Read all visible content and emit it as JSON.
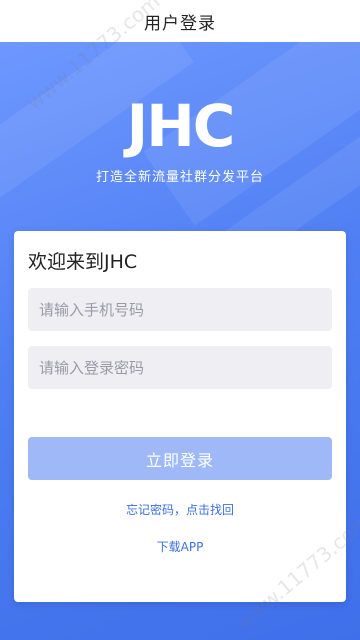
{
  "header": {
    "title": "用户登录"
  },
  "hero": {
    "logo_text": "JHC",
    "slogan": "打造全新流量社群分发平台"
  },
  "login_card": {
    "welcome": "欢迎来到JHC",
    "phone_placeholder": "请输入手机号码",
    "password_placeholder": "请输入登录密码",
    "login_button": "立即登录",
    "forgot_link": "忘记密码，点击找回",
    "download_link": "下载APP"
  },
  "watermark": {
    "text": "www.11773.com"
  },
  "colors": {
    "brand_blue": "#4f7ff3",
    "button_disabled": "#9fb8f7",
    "link": "#3d6fe0",
    "input_bg": "#efeff3"
  }
}
